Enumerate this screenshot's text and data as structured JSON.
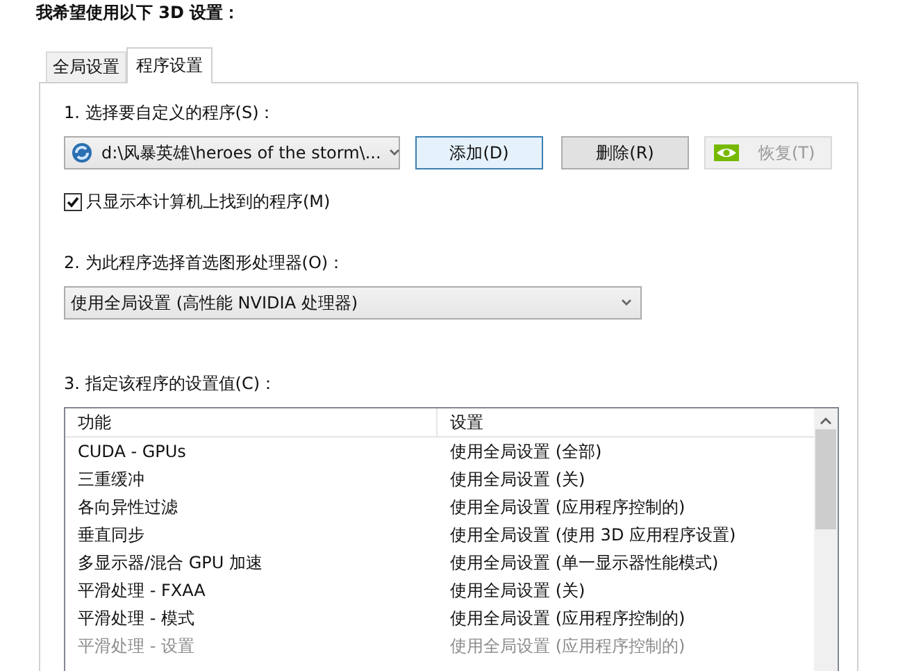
{
  "heading": "我希望使用以下 3D 设置：",
  "tabs": [
    {
      "label": "全局设置",
      "selected": false
    },
    {
      "label": "程序设置",
      "selected": true
    }
  ],
  "program_section": {
    "label": "1. 选择要自定义的程序(S)：",
    "program_select": {
      "value": "d:\\风暴英雄\\heroes of the storm\\..."
    },
    "buttons": [
      {
        "label": "添加(D)",
        "kind": "focused",
        "disabled": false
      },
      {
        "label": "删除(R)",
        "kind": "plain",
        "disabled": false
      },
      {
        "label": "恢复(T)",
        "kind": "nvidia",
        "disabled": true
      }
    ],
    "only_found_checkbox": {
      "label": "只显示本计算机上找到的程序(M)",
      "checked": true
    }
  },
  "gpu_section": {
    "label": "2. 为此程序选择首选图形处理器(O)：",
    "gpu_select": {
      "value": "使用全局设置 (高性能 NVIDIA 处理器)"
    }
  },
  "settings_section": {
    "label": "3. 指定该程序的设置值(C)：",
    "table": {
      "columns": [
        "功能",
        "设置"
      ],
      "rows": [
        {
          "feature": "CUDA - GPUs",
          "setting": "使用全局设置 (全部)",
          "disabled": false
        },
        {
          "feature": "三重缓冲",
          "setting": "使用全局设置 (关)",
          "disabled": false
        },
        {
          "feature": "各向异性过滤",
          "setting": "使用全局设置 (应用程序控制的)",
          "disabled": false
        },
        {
          "feature": "垂直同步",
          "setting": "使用全局设置 (使用 3D 应用程序设置)",
          "disabled": false
        },
        {
          "feature": "多显示器/混合 GPU 加速",
          "setting": "使用全局设置 (单一显示器性能模式)",
          "disabled": false
        },
        {
          "feature": "平滑处理 - FXAA",
          "setting": "使用全局设置 (关)",
          "disabled": false
        },
        {
          "feature": "平滑处理 - 模式",
          "setting": "使用全局设置 (应用程序控制的)",
          "disabled": false
        },
        {
          "feature": "平滑处理 - 设置",
          "setting": "使用全局设置 (应用程序控制的)",
          "disabled": true
        }
      ]
    }
  }
}
